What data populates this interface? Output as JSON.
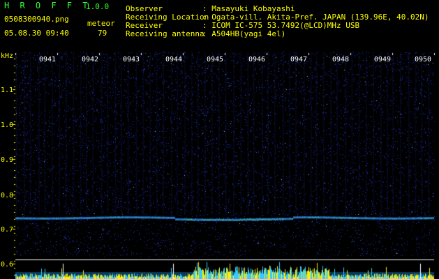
{
  "app": {
    "name": "H R O F F T",
    "version": "1.0.0"
  },
  "file": {
    "name": "0508300940.png",
    "timestamp": "05.08.30 09:40"
  },
  "meteor": {
    "label": "meteor",
    "count": "79"
  },
  "info": [
    {
      "key": "Observer",
      "value": ": Masayuki Kobayashi"
    },
    {
      "key": "Receiving Location",
      "value": ": Ogata-vill. Akita-Pref. JAPAN (139.96E, 40.02N)"
    },
    {
      "key": "Receiver",
      "value": ": ICOM IC-575 53.7492(@LCD)MHz USB"
    },
    {
      "key": "Receiving antenna",
      "value": ": A504HB(yagi 4el)"
    }
  ],
  "y_axis": {
    "unit": "kHz",
    "ticks": [
      "1.1",
      "1.0",
      "0.9",
      "0.8",
      "0.7",
      "0.6"
    ]
  },
  "time_marks": [
    "0941",
    "0942",
    "0943",
    "0944",
    "0945",
    "0946",
    "0947",
    "0948",
    "0949",
    "0950"
  ],
  "colors": {
    "header_text": "#ffff00",
    "title_text": "#33ff33",
    "minute_text": "#ffffff",
    "background": "#000000",
    "noise": "#1a2a9a",
    "signal": "#22cc55",
    "level_bars": "#ffee00"
  }
}
